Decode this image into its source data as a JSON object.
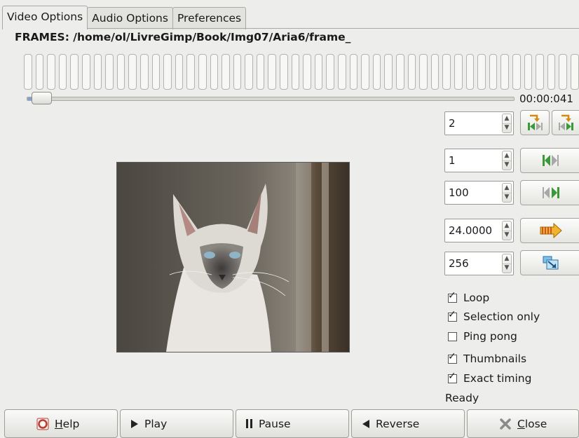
{
  "tabs": [
    {
      "label": "Video Options",
      "active": true
    },
    {
      "label": "Audio Options",
      "active": false
    },
    {
      "label": "Preferences",
      "active": false
    }
  ],
  "frames_path": "FRAMES: /home/ol/LivreGimp/Book/Img07/Aria6/frame_",
  "timecode": "00:00:041",
  "spin_fields": {
    "step": "2",
    "range_from": "1",
    "range_to": "100",
    "speed": "24.0000",
    "size": "256"
  },
  "checkboxes": [
    {
      "label": "Loop",
      "checked": true
    },
    {
      "label": "Selection only",
      "checked": true
    },
    {
      "label": "Ping pong",
      "checked": false
    },
    {
      "label": "Thumbnails",
      "checked": true
    },
    {
      "label": "Exact timing",
      "checked": true
    }
  ],
  "status": "Ready",
  "buttons": {
    "help_prefix": "",
    "help_mnemonic": "H",
    "help_rest": "elp",
    "play": "Play",
    "pause": "Pause",
    "reverse": "Reverse",
    "close_mnemonic": "C",
    "close_rest": "lose"
  },
  "colors": {
    "accent": "#7aa2d6",
    "icon_green": "#3a9a3a",
    "icon_orange": "#e29a1a"
  }
}
